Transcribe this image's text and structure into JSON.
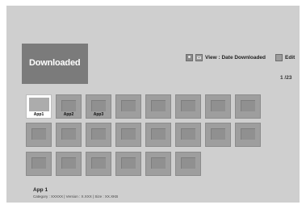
{
  "header": {
    "title": "Downloaded"
  },
  "toolbar": {
    "icons": [
      "user-icon",
      "view-icon",
      "edit-icon"
    ],
    "view_label": "View : Date Downloaded",
    "edit_label": "Edit"
  },
  "page_indicator": "1 /23",
  "apps": [
    {
      "label": "App1",
      "selected": true
    },
    {
      "label": "App2",
      "selected": false
    },
    {
      "label": "App3",
      "selected": false
    }
  ],
  "footer": {
    "name": "App 1",
    "meta": "Category : XXXXX  |  Version : X.XXX  |  Size : XX.XKB"
  },
  "colors": {
    "background": "#cfcfcf",
    "header_tab": "#7b7b7b",
    "tile": "#9e9e9e",
    "selected_tile": "#ffffff"
  }
}
